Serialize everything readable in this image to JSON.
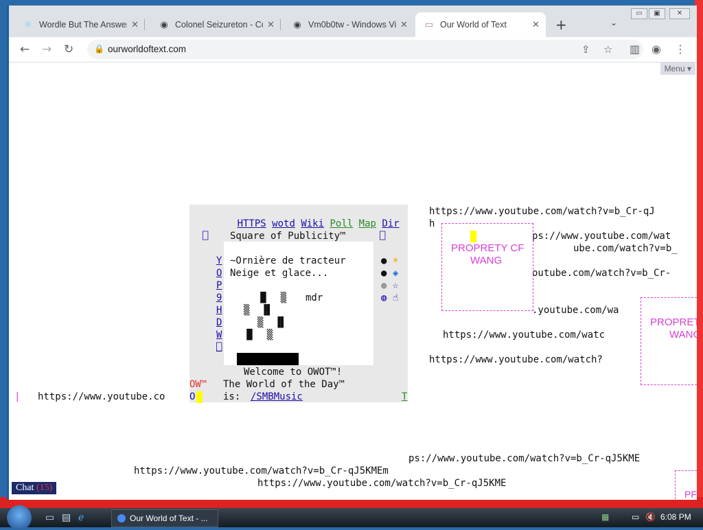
{
  "browser": {
    "tabs": [
      {
        "title": "Wordle But The Answer",
        "icon": "react-icon"
      },
      {
        "title": "Colonel Seizureton - Co",
        "icon": "github-icon"
      },
      {
        "title": "Vm0b0tw - Windows Vi",
        "icon": "github-icon"
      },
      {
        "title": "Our World of Text",
        "icon": "scroll-icon"
      }
    ],
    "url": "ourworldoftext.com"
  },
  "page": {
    "menu": "Menu",
    "links": [
      "HTTPS",
      "wotd",
      "Wiki",
      "Poll",
      "Map",
      "Dir"
    ],
    "square_title": "Square of Publicity™",
    "side_letters": [
      "Y",
      "O",
      "P",
      "9",
      "H",
      "D",
      "W",
      "⎕"
    ],
    "line1": "~Ornière de tracteur",
    "line2": "Neige et glace...",
    "mdr": "mdr",
    "welcome": "Welcome to OWOT™!",
    "wotd_line": "The World of the Day™",
    "is": "is:",
    "wotd_link": "/SMBMusic",
    "ow": "OW™",
    "t_link": "T",
    "left_url": "https://www.youtube.co",
    "o_char": "O",
    "urls": [
      "https://www.youtube.com/watch?v=b_Cr-qJ",
      "h",
      "ps://www.youtube.com/wat",
      "ube.com/watch?v=b_",
      "outube.com/watch?v=b_Cr-",
      ".youtube.com/wa",
      "https://www.youtube.com/watc",
      "https://www.youtube.com/watch?",
      "ps://www.youtube.com/watch?v=b_Cr-qJ5KME",
      "https://www.youtube.com/watch?v=b_Cr-qJ5KMEm",
      "https://www.youtube.com/watch?v=b_Cr-qJ5KME"
    ],
    "property1_a": "PROPRETY CF",
    "property1_b": "WANG",
    "property2_a": "PROPRET",
    "property2_b": "WANG",
    "property3": "PF",
    "chat_label": "Chat",
    "chat_count": "(15)"
  },
  "taskbar": {
    "window_label": "Our World of Text - ...",
    "time": "6:08 PM"
  }
}
